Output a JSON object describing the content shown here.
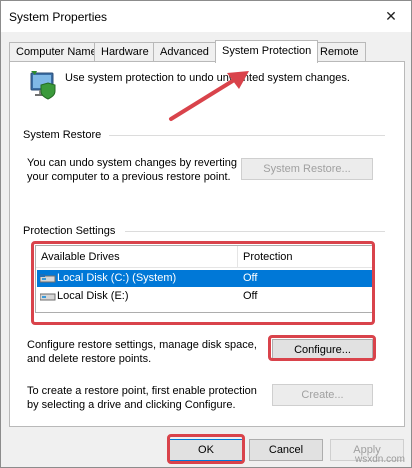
{
  "window": {
    "title": "System Properties",
    "close_glyph": "✕"
  },
  "tabs": [
    {
      "label": "Computer Name",
      "active": false
    },
    {
      "label": "Hardware",
      "active": false
    },
    {
      "label": "Advanced",
      "active": false
    },
    {
      "label": "System Protection",
      "active": true
    },
    {
      "label": "Remote",
      "active": false
    }
  ],
  "intro": {
    "icon": "computer-shield-icon",
    "text": "Use system protection to undo unwanted system changes."
  },
  "system_restore": {
    "label": "System Restore",
    "description_line1": "You can undo system changes by reverting",
    "description_line2": "your computer to a previous restore point.",
    "button_label": "System Restore...",
    "button_enabled": false
  },
  "protection_settings": {
    "label": "Protection Settings",
    "columns": [
      "Available Drives",
      "Protection"
    ],
    "drives": [
      {
        "name": "Local Disk (C:) (System)",
        "protection": "Off",
        "selected": true,
        "icon": "system-drive-icon"
      },
      {
        "name": "Local Disk (E:)",
        "protection": "Off",
        "selected": false,
        "icon": "drive-icon"
      }
    ],
    "configure_text_line1": "Configure restore settings, manage disk space,",
    "configure_text_line2": "and delete restore points.",
    "configure_button": "Configure...",
    "create_text_line1": "To create a restore point, first enable protection",
    "create_text_line2": "by selecting a drive and clicking Configure.",
    "create_button": "Create...",
    "create_enabled": false
  },
  "footer": {
    "ok": "OK",
    "cancel": "Cancel",
    "apply": "Apply",
    "apply_enabled": false
  },
  "annotation": {
    "highlight_color": "#d9434b"
  },
  "watermark": "wsxdn.com"
}
